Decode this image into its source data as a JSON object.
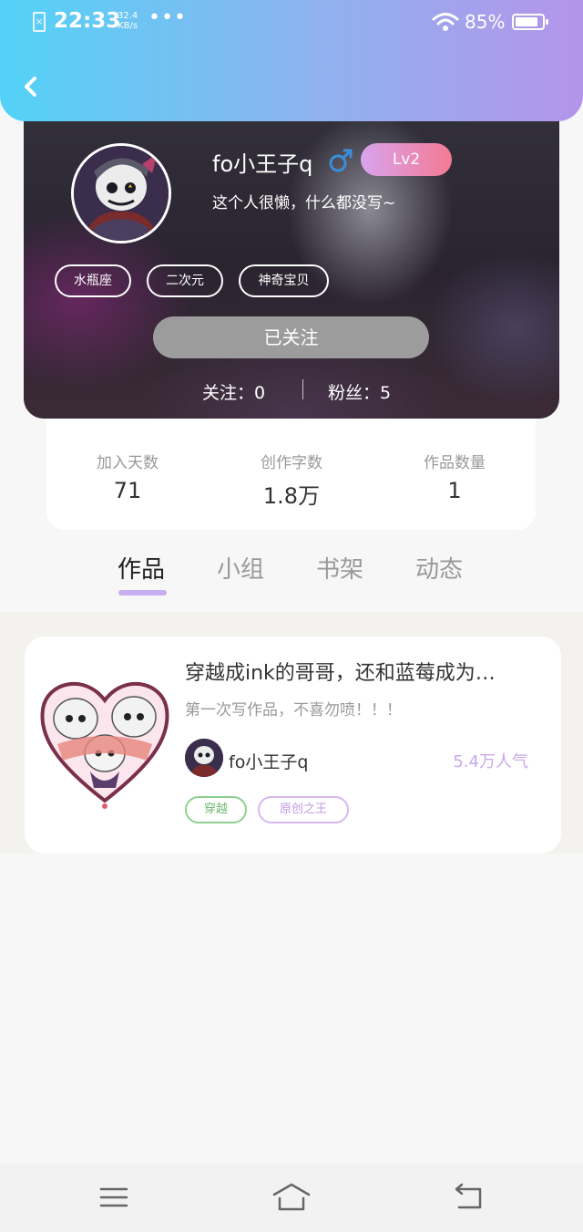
{
  "status_bar": {
    "time": "22:33",
    "net_speed_value": "32.4",
    "net_speed_unit": "KB/s",
    "more": "•••",
    "battery": "85%",
    "battery_level": 0.85,
    "sim_icon": "sim-card-x-icon",
    "wifi_icon": "wifi-icon"
  },
  "header": {
    "back_icon": "chevron-left-icon"
  },
  "profile": {
    "username": "fo小王子q",
    "gender_icon": "male-icon",
    "level": "Lv2",
    "bio": "这个人很懒，什么都没写~",
    "tags": [
      "水瓶座",
      "二次元",
      "神奇宝贝"
    ],
    "follow_button": "已关注",
    "following": "关注：0",
    "fans": "粉丝：5"
  },
  "stats": [
    {
      "label": "加入天数",
      "value": "71"
    },
    {
      "label": "创作字数",
      "value": "1.8万"
    },
    {
      "label": "作品数量",
      "value": "1"
    }
  ],
  "tabs": [
    "作品",
    "小组",
    "书架",
    "动态"
  ],
  "active_tab": "作品",
  "works": [
    {
      "title": "穿越成ink的哥哥，还和蓝莓成为…",
      "description": "第一次写作品，不喜勿喷！！！",
      "author": "fo小王子q",
      "popularity": "5.4万人气",
      "tags": [
        "穿越",
        "原创之王"
      ]
    }
  ],
  "colors": {
    "header_gradient_start": "#53d2f7",
    "header_gradient_end": "#b494ea",
    "accent_purple": "#c6aef0",
    "level_gradient_start": "#d8a4ee",
    "level_gradient_end": "#f47a92",
    "tag_green": "#8fcf8f",
    "tag_purple": "#d4b8ee",
    "male_blue": "#3a8fd8"
  },
  "nav_bar": {
    "menu_icon": "menu-icon",
    "home_icon": "home-icon",
    "back_icon": "back-arrow-icon"
  }
}
